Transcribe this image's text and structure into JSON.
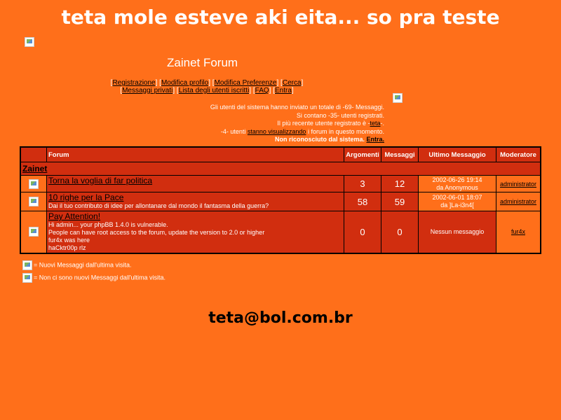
{
  "header": {
    "hack_title": "teta mole esteve aki eita... so pra teste",
    "forum_title": "Zainet Forum"
  },
  "nav": {
    "row1": [
      "Registrazione",
      "Modifica profilo",
      "Modifica Preferenze",
      "Cerca"
    ],
    "row2": [
      "Messaggi privati",
      "Lista degli utenti iscritti",
      "FAQ",
      "Entra"
    ]
  },
  "stats": {
    "line1": "Gli utenti del sistema hanno inviato un totale di -69- Messaggi.",
    "line2": "Si contano -35- utenti registrati.",
    "line3_pre": "Il più recente utente registrato è -",
    "line3_user": "teta",
    "line3_post": "-.",
    "line4_pre": "-4- utenti ",
    "line4_link": "stanno visualizzando",
    "line4_post": " i forum in questo momento.",
    "line5_pre": "Non riconosciuto dal sistema. ",
    "line5_link": "Entra."
  },
  "table": {
    "headers": {
      "forum": "Forum",
      "topics": "Argomenti",
      "posts": "Messaggi",
      "last_post": "Ultimo Messaggio",
      "moderator": "Moderatore"
    },
    "category": "Zainet",
    "rows": [
      {
        "name": "Torna la voglia di far politica",
        "desc": "",
        "topics": "3",
        "posts": "12",
        "last_line1": "2002-06-26 19:14",
        "last_line2": "da Anonymous",
        "moderator": "administrator"
      },
      {
        "name": "10 righe per la Pace",
        "desc": "Dai il tuo contributo di idee per allontanare dal mondo il fantasma della guerra?",
        "topics": "58",
        "posts": "59",
        "last_line1": "2002-06-01 18:07",
        "last_line2": "da ]La-i3n4[",
        "moderator": "administrator"
      },
      {
        "name": "Pay Attention!",
        "desc_lines": [
          "Hi admin... your phpBB 1.4.0 is vulnerable.",
          "People can have root access to the forum, update the version to 2.0 or higher",
          "fur4x was here",
          "haCktr00p rlz"
        ],
        "topics": "0",
        "posts": "0",
        "last_line1": "Nessun messaggio",
        "last_line2": "",
        "moderator": "fur4x"
      }
    ]
  },
  "legend": {
    "new": "= Nuovi Messaggi dall'ultima visita.",
    "no_new": "= Non ci sono nuovi Messaggi dall'ultima visita."
  },
  "footer": {
    "email": "teta@bol.com.br"
  }
}
